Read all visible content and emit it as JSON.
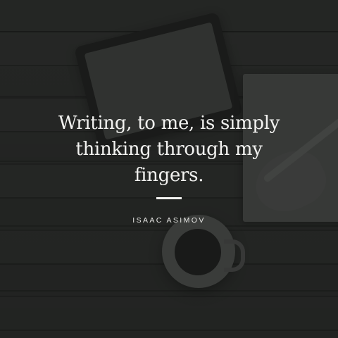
{
  "quote": {
    "text": "Writing, to me, is simply thinking through my fingers.",
    "author": "ISAAC ASIMOV"
  }
}
